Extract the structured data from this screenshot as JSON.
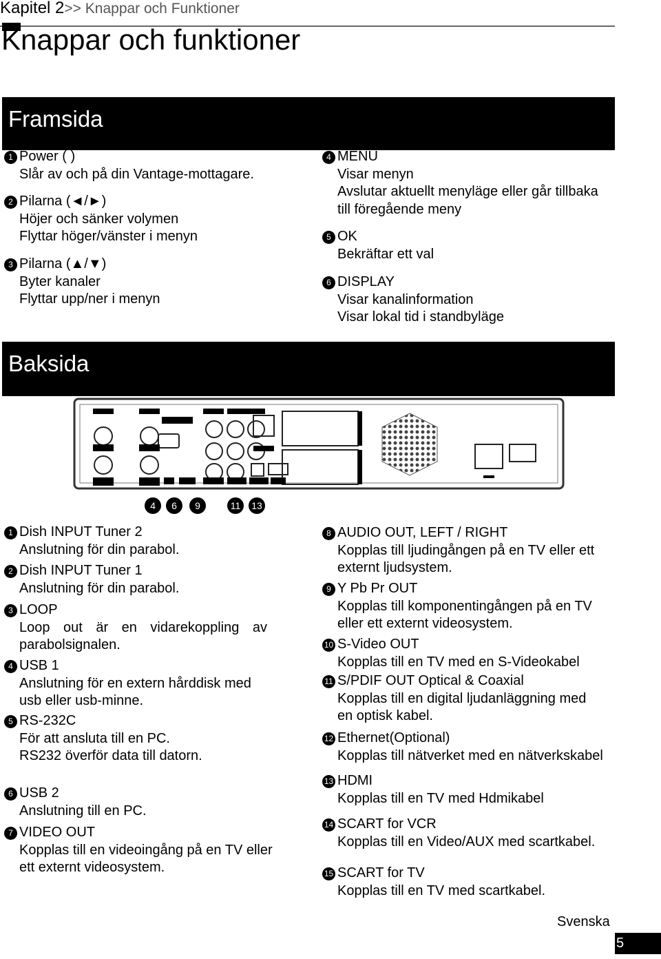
{
  "header": {
    "chapter": "Kapitel 2",
    "breadcrumb": ">> Knappar och Funktioner",
    "title": "Knappar och funktioner"
  },
  "front": {
    "heading": "Framsida",
    "items": [
      {
        "num": "1",
        "title": "Power ( )",
        "lines": [
          "Slår av och på din Vantage-mottagare."
        ]
      },
      {
        "num": "2",
        "title": "Pilarna (◄/►)",
        "lines": [
          "Höjer och sänker volymen",
          "Flyttar höger/vänster i menyn"
        ]
      },
      {
        "num": "3",
        "title": "Pilarna (▲/▼)",
        "lines": [
          "Byter kanaler",
          "Flyttar upp/ner i menyn"
        ]
      },
      {
        "num": "4",
        "title": "MENU",
        "lines": [
          "Visar menyn",
          "Avslutar aktuellt menyläge eller går tillbaka",
          "till föregående meny"
        ]
      },
      {
        "num": "5",
        "title": "OK",
        "lines": [
          "Bekräftar ett val"
        ]
      },
      {
        "num": "6",
        "title": "DISPLAY",
        "lines": [
          "Visar kanalinformation",
          "Visar lokal tid i standbyläge"
        ]
      }
    ]
  },
  "back": {
    "heading": "Baksida",
    "callouts": [
      "4",
      "6",
      "9",
      "11",
      "13"
    ],
    "items": [
      {
        "num": "1",
        "title": "Dish INPUT Tuner 2",
        "lines": [
          "Anslutning för din parabol."
        ]
      },
      {
        "num": "2",
        "title": "Dish INPUT Tuner 1",
        "lines": [
          "Anslutning för din parabol."
        ]
      },
      {
        "num": "3",
        "title": "LOOP",
        "lines": [
          "Loop out är en vidarekoppling av parabolsignalen."
        ]
      },
      {
        "num": "4",
        "title": "USB 1",
        "lines": [
          "Anslutning för en extern hårddisk med",
          "usb eller usb-minne."
        ]
      },
      {
        "num": "5",
        "title": "RS-232C",
        "lines": [
          "För att ansluta till en PC.",
          "RS232 överför data till datorn."
        ]
      },
      {
        "num": "6",
        "title": "USB 2",
        "lines": [
          "Anslutning till en PC."
        ]
      },
      {
        "num": "7",
        "title": "VIDEO OUT",
        "lines": [
          "Kopplas till en videoingång på en TV eller",
          "ett externt videosystem."
        ]
      },
      {
        "num": "8",
        "title": "AUDIO OUT, LEFT / RIGHT",
        "lines": [
          "Kopplas till ljudingången på en TV eller ett",
          "externt ljudsystem."
        ]
      },
      {
        "num": "9",
        "title": "Y Pb Pr OUT",
        "lines": [
          "Kopplas till komponentingången på en TV",
          "eller ett externt videosystem."
        ]
      },
      {
        "num": "10",
        "title": "S-Video OUT",
        "lines": [
          "Kopplas till en TV med en S-Videokabel"
        ]
      },
      {
        "num": "11",
        "title": "S/PDIF OUT Optical & Coaxial",
        "lines": [
          " Kopplas till en digital ljudanläggning med",
          "en optisk kabel."
        ]
      },
      {
        "num": "12",
        "title": "Ethernet(Optional)",
        "lines": [
          "Kopplas till nätverket med en nätverkskabel"
        ]
      },
      {
        "num": "13",
        "title": "HDMI",
        "lines": [
          " Kopplas till en TV med Hdmikabel"
        ]
      },
      {
        "num": "14",
        "title": " SCART for VCR",
        "lines": [
          " Kopplas till en Video/AUX med scartkabel."
        ]
      },
      {
        "num": "15",
        "title": "SCART for TV",
        "lines": [
          "Kopplas till en TV med scartkabel."
        ]
      }
    ]
  },
  "footer": {
    "language": "Svenska",
    "page": "5"
  }
}
